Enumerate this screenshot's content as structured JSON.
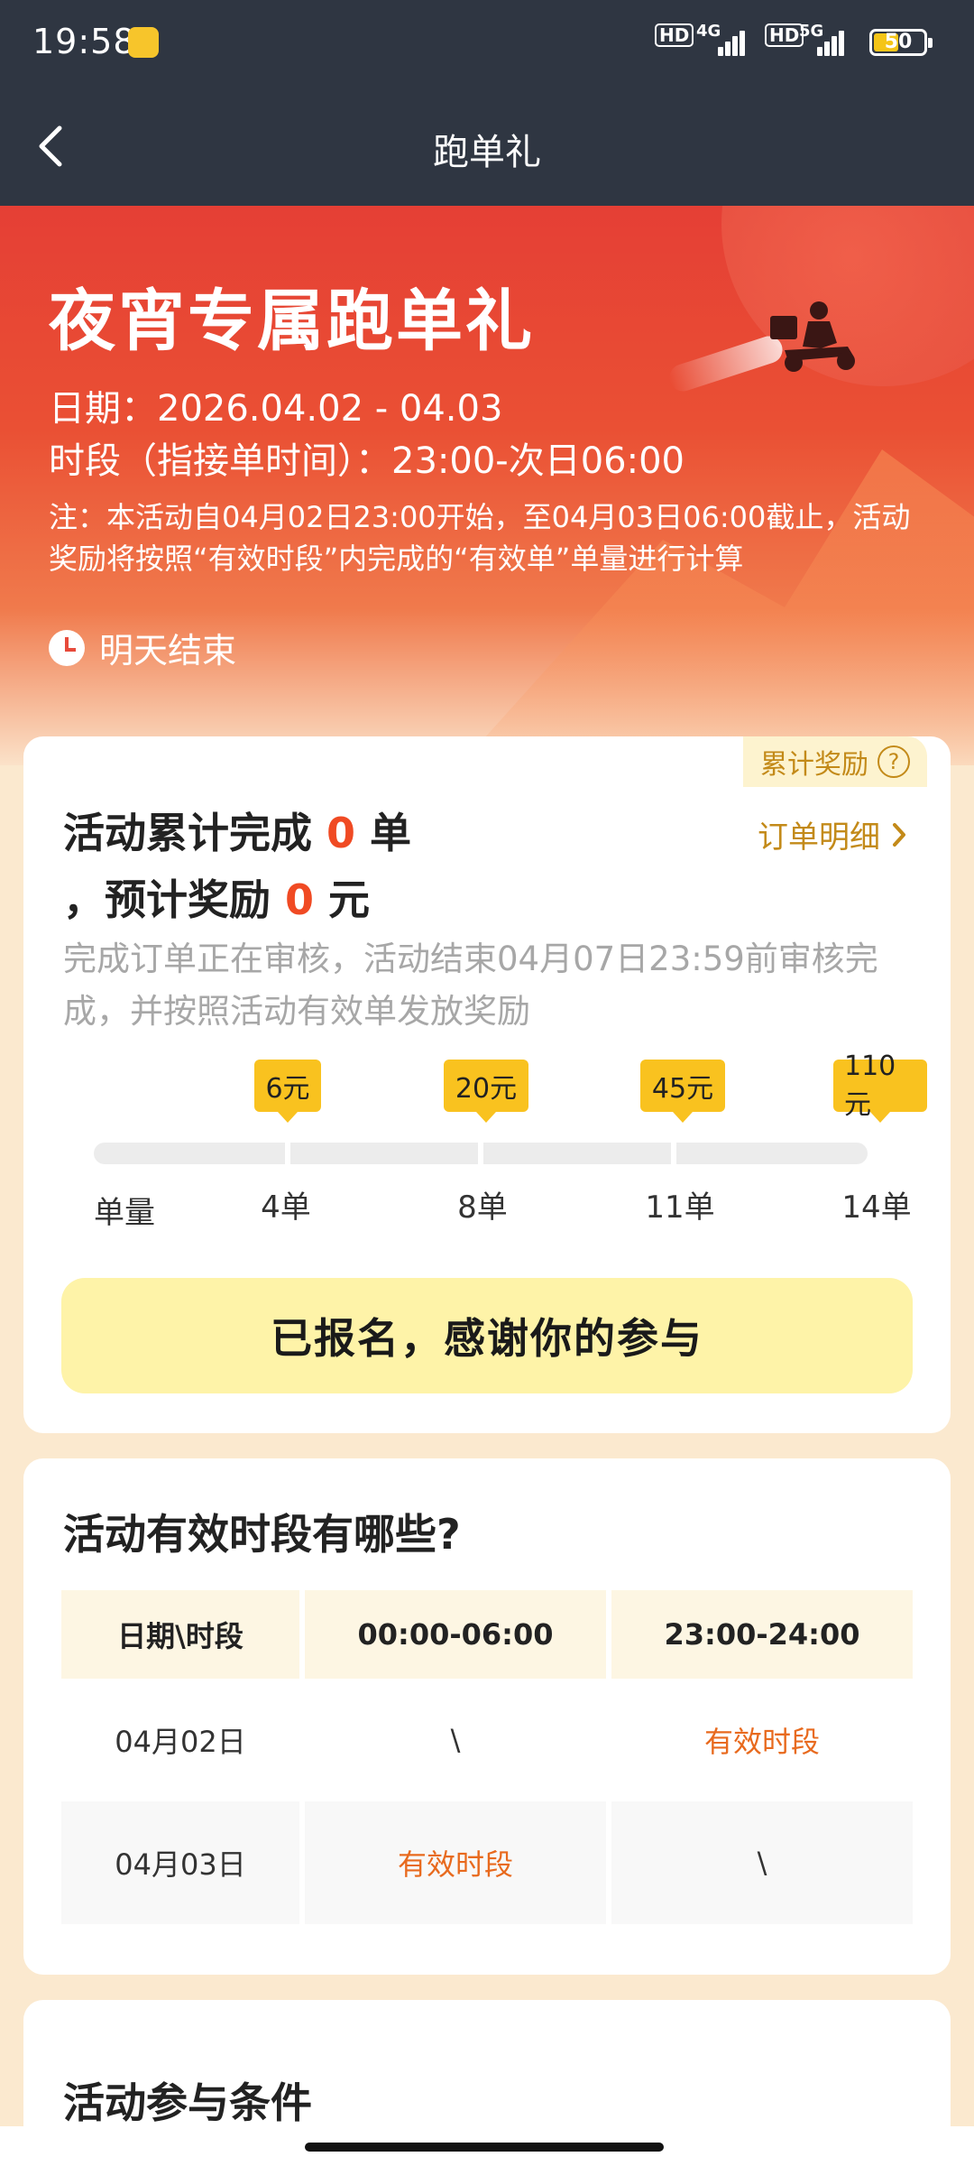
{
  "status": {
    "time": "19:58",
    "net1": "4G",
    "net2": "5G",
    "hd": "HD",
    "battery": "50"
  },
  "nav": {
    "title": "跑单礼"
  },
  "hero": {
    "title": "夜宵专属跑单礼",
    "date": "日期：2026.04.02 - 04.03",
    "period": "时段（指接单时间）：23:00-次日06:00",
    "note": "注：本活动自04月02日23:00开始，至04月03日06:00截止，活动奖励将按照“有效时段”内完成的“有效单”单量进行计算",
    "end_text": "明天结束"
  },
  "progress_card": {
    "cumulative_tag": "累计奖励",
    "summary_prefix": "活动累计完成",
    "orders_done": "0",
    "unit_orders": "单",
    "reward_prefix": "，预计奖励",
    "reward_amount": "0",
    "unit_yuan": "元",
    "order_detail_link": "订单明细",
    "review_note": "完成订单正在审核，活动结束04月07日23:59前审核完成，并按照活动有效单发放奖励",
    "axis_label": "单量",
    "tiers": [
      {
        "reward": "6元",
        "orders": "4单"
      },
      {
        "reward": "20元",
        "orders": "8单"
      },
      {
        "reward": "45元",
        "orders": "11单"
      },
      {
        "reward": "110元",
        "orders": "14单"
      }
    ],
    "cta": "已报名，感谢你的参与"
  },
  "periods_card": {
    "title": "活动有效时段有哪些?",
    "headers": [
      "日期\\时段",
      "00:00-06:00",
      "23:00-24:00"
    ],
    "rows": [
      [
        "04月02日",
        "\\",
        "有效时段"
      ],
      [
        "04月03日",
        "有效时段",
        "\\"
      ]
    ]
  },
  "conditions_card": {
    "title": "活动参与条件"
  },
  "colors": {
    "accent_red": "#f04a23",
    "gold": "#c38a19",
    "tag_yellow": "#f9c21f",
    "valid_orange": "#e86a1e"
  }
}
